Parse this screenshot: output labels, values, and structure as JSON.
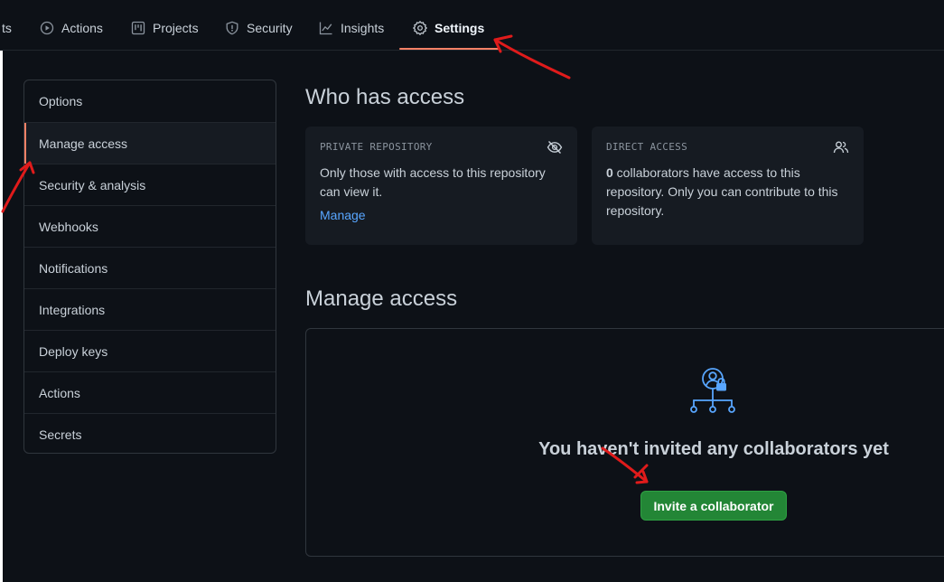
{
  "topnav": {
    "partial_tab_label": "ts",
    "tabs": [
      {
        "label": "Actions",
        "icon": "play-circle-icon"
      },
      {
        "label": "Projects",
        "icon": "project-board-icon"
      },
      {
        "label": "Security",
        "icon": "shield-icon"
      },
      {
        "label": "Insights",
        "icon": "graph-icon"
      },
      {
        "label": "Settings",
        "icon": "gear-icon",
        "active": true
      }
    ]
  },
  "sidebar": {
    "items": [
      {
        "label": "Options"
      },
      {
        "label": "Manage access",
        "selected": true
      },
      {
        "label": "Security & analysis"
      },
      {
        "label": "Webhooks"
      },
      {
        "label": "Notifications"
      },
      {
        "label": "Integrations"
      },
      {
        "label": "Deploy keys"
      },
      {
        "label": "Actions"
      },
      {
        "label": "Secrets"
      }
    ]
  },
  "who_has_access": {
    "title": "Who has access",
    "private_card": {
      "caption": "PRIVATE REPOSITORY",
      "icon": "eye-closed-icon",
      "text": "Only those with access to this repository can view it.",
      "link": "Manage"
    },
    "direct_card": {
      "caption": "DIRECT ACCESS",
      "icon": "people-icon",
      "count": "0",
      "text": " collaborators have access to this repository. Only you can contribute to this repository."
    }
  },
  "manage_access": {
    "title": "Manage access",
    "empty_icon": "collaborators-lock-icon",
    "empty_message": "You haven't invited any collaborators yet",
    "invite_button": "Invite a collaborator"
  },
  "colors": {
    "background": "#0d1117",
    "card": "#161b22",
    "accent_tab": "#f78166",
    "link": "#58a6ff",
    "button": "#238636",
    "annotation": "#e01b1b"
  }
}
